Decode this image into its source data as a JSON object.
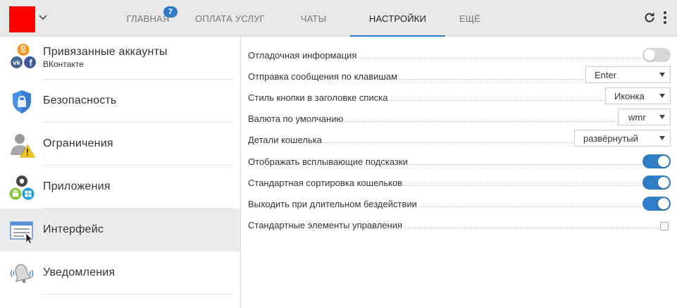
{
  "brand_color": "#ff0000",
  "accent_color": "#2f7cc7",
  "nav": {
    "tabs": [
      {
        "label": "ГЛАВНАЯ",
        "badge": "7"
      },
      {
        "label": "ОПЛАТА УСЛУГ"
      },
      {
        "label": "ЧАТЫ"
      },
      {
        "label": "НАСТРОЙКИ",
        "active": true
      },
      {
        "label": "ЕЩЁ"
      }
    ],
    "icons": [
      "chevron-down-icon",
      "refresh-icon",
      "more-vertical-icon"
    ]
  },
  "sidebar": {
    "items": [
      {
        "label": "Привязанные аккаунты",
        "sublabel": "ВКонтакте",
        "icon": "linked-accounts-icon"
      },
      {
        "label": "Безопасность",
        "icon": "shield-lock-icon"
      },
      {
        "label": "Ограничения",
        "icon": "user-warning-icon"
      },
      {
        "label": "Приложения",
        "icon": "apps-platforms-icon"
      },
      {
        "label": "Интерфейс",
        "icon": "interface-window-icon",
        "active": true
      },
      {
        "label": "Уведомления",
        "icon": "bell-icon"
      }
    ]
  },
  "settings": {
    "debug": {
      "label": "Отладочная информация",
      "toggle": "off"
    },
    "send_key": {
      "label": "Отправка сообщения по клавишам",
      "value": "Enter"
    },
    "button_style": {
      "label": "Стиль кнопки в заголовке списка",
      "value": "Иконка"
    },
    "currency": {
      "label": "Валюта по умолчанию",
      "value": "wmr"
    },
    "wallet_details": {
      "label": "Детали кошелька",
      "value": "развёрнутый"
    },
    "tooltips": {
      "label": "Отображать всплывающие подсказки",
      "toggle": "on"
    },
    "wallet_sort": {
      "label": "Стандартная сортировка кошельков",
      "toggle": "on"
    },
    "idle_logout": {
      "label": "Выходить при длительном бездействии",
      "toggle": "on"
    },
    "std_controls": {
      "label": "Стандартные элементы управления",
      "checked": false
    }
  }
}
